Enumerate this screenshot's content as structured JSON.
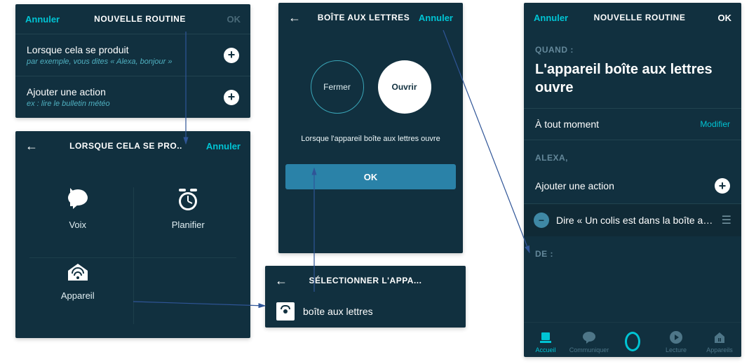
{
  "panel1": {
    "cancel": "Annuler",
    "title": "NOUVELLE ROUTINE",
    "ok": "OK",
    "when_h": "Lorsque cela se produit",
    "when_s": "par exemple, vous dites « Alexa, bonjour »",
    "action_h": "Ajouter une action",
    "action_s": "ex : lire le bulletin météo"
  },
  "panel2": {
    "title": "LORSQUE CELA SE PRO..",
    "cancel": "Annuler",
    "triggers": {
      "voice": "Voix",
      "schedule": "Planifier",
      "device": "Appareil"
    }
  },
  "panel3": {
    "title": "BOÎTE AUX LETTRES",
    "cancel": "Annuler",
    "close_btn": "Fermer",
    "open_btn": "Ouvrir",
    "caption": "Lorsque l'appareil boîte aux lettres ouvre",
    "ok": "OK"
  },
  "panel4": {
    "title": "SÉLECTIONNER L'APPA...",
    "device": "boîte aux lettres"
  },
  "panel5": {
    "cancel": "Annuler",
    "title": "NOUVELLE ROUTINE",
    "ok": "OK",
    "when_label": "QUAND :",
    "when_text": "L'appareil boîte aux lettres ouvre",
    "anytime": "À tout moment",
    "modify": "Modifier",
    "alexa_label": "ALEXA,",
    "add_action": "Ajouter une action",
    "action_text": "Dire « Un colis est dans la boîte au...",
    "from_label": "DE :",
    "nav": {
      "home": "Accueil",
      "comm": "Communiquer",
      "play": "Lecture",
      "devices": "Appareils"
    }
  }
}
